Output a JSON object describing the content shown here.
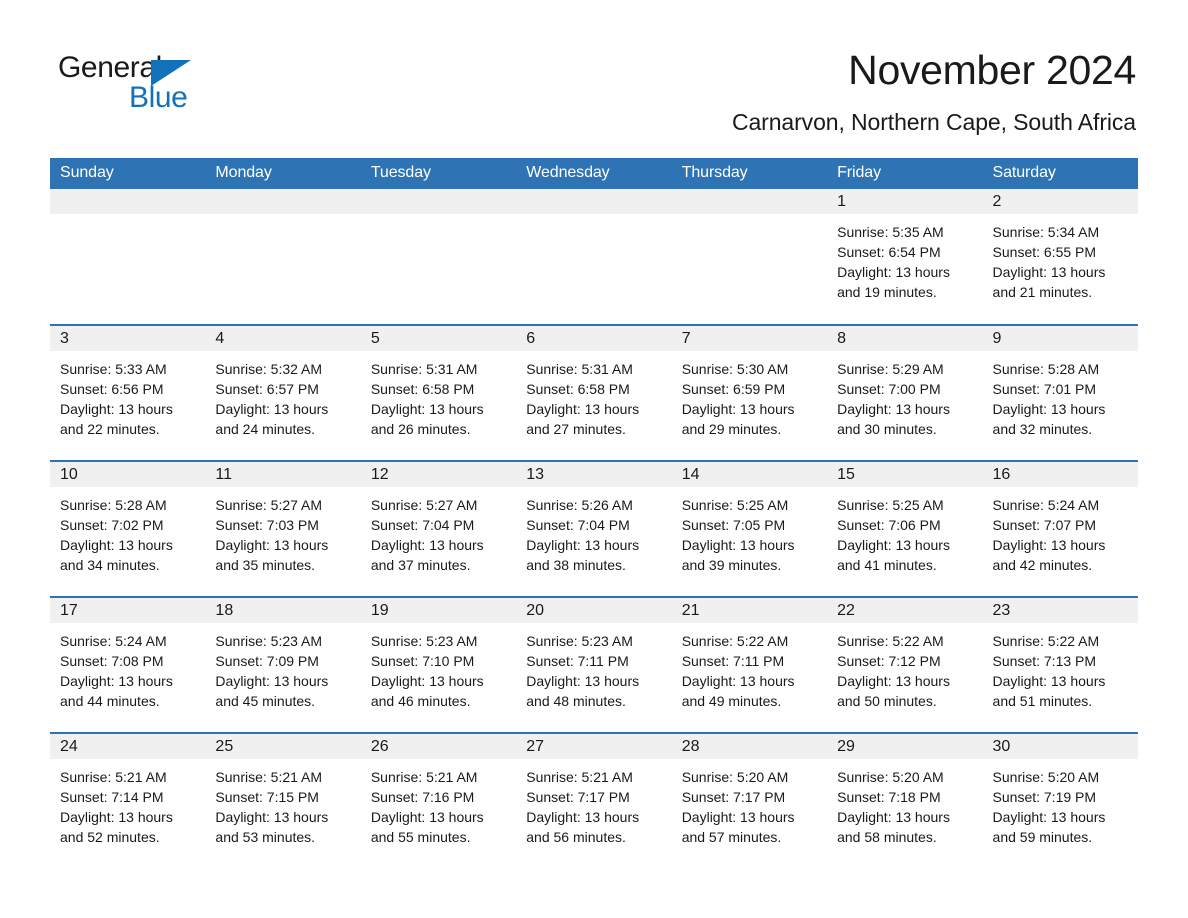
{
  "brand": {
    "logo_word_1": "General",
    "logo_word_2": "Blue",
    "logo_icon": "triangle-icon",
    "accent_color": "#1271bb"
  },
  "header": {
    "title": "November 2024",
    "subtitle": "Carnarvon, Northern Cape, South Africa"
  },
  "theme": {
    "header_blue": "#2e74b5",
    "daynum_band": "#f0f0f0",
    "text": "#1a1a1a"
  },
  "weekday_headers": [
    "Sunday",
    "Monday",
    "Tuesday",
    "Wednesday",
    "Thursday",
    "Friday",
    "Saturday"
  ],
  "weeks": [
    [
      {
        "day": "",
        "lines": []
      },
      {
        "day": "",
        "lines": []
      },
      {
        "day": "",
        "lines": []
      },
      {
        "day": "",
        "lines": []
      },
      {
        "day": "",
        "lines": []
      },
      {
        "day": "1",
        "lines": [
          "Sunrise: 5:35 AM",
          "Sunset: 6:54 PM",
          "Daylight: 13 hours",
          "and 19 minutes."
        ]
      },
      {
        "day": "2",
        "lines": [
          "Sunrise: 5:34 AM",
          "Sunset: 6:55 PM",
          "Daylight: 13 hours",
          "and 21 minutes."
        ]
      }
    ],
    [
      {
        "day": "3",
        "lines": [
          "Sunrise: 5:33 AM",
          "Sunset: 6:56 PM",
          "Daylight: 13 hours",
          "and 22 minutes."
        ]
      },
      {
        "day": "4",
        "lines": [
          "Sunrise: 5:32 AM",
          "Sunset: 6:57 PM",
          "Daylight: 13 hours",
          "and 24 minutes."
        ]
      },
      {
        "day": "5",
        "lines": [
          "Sunrise: 5:31 AM",
          "Sunset: 6:58 PM",
          "Daylight: 13 hours",
          "and 26 minutes."
        ]
      },
      {
        "day": "6",
        "lines": [
          "Sunrise: 5:31 AM",
          "Sunset: 6:58 PM",
          "Daylight: 13 hours",
          "and 27 minutes."
        ]
      },
      {
        "day": "7",
        "lines": [
          "Sunrise: 5:30 AM",
          "Sunset: 6:59 PM",
          "Daylight: 13 hours",
          "and 29 minutes."
        ]
      },
      {
        "day": "8",
        "lines": [
          "Sunrise: 5:29 AM",
          "Sunset: 7:00 PM",
          "Daylight: 13 hours",
          "and 30 minutes."
        ]
      },
      {
        "day": "9",
        "lines": [
          "Sunrise: 5:28 AM",
          "Sunset: 7:01 PM",
          "Daylight: 13 hours",
          "and 32 minutes."
        ]
      }
    ],
    [
      {
        "day": "10",
        "lines": [
          "Sunrise: 5:28 AM",
          "Sunset: 7:02 PM",
          "Daylight: 13 hours",
          "and 34 minutes."
        ]
      },
      {
        "day": "11",
        "lines": [
          "Sunrise: 5:27 AM",
          "Sunset: 7:03 PM",
          "Daylight: 13 hours",
          "and 35 minutes."
        ]
      },
      {
        "day": "12",
        "lines": [
          "Sunrise: 5:27 AM",
          "Sunset: 7:04 PM",
          "Daylight: 13 hours",
          "and 37 minutes."
        ]
      },
      {
        "day": "13",
        "lines": [
          "Sunrise: 5:26 AM",
          "Sunset: 7:04 PM",
          "Daylight: 13 hours",
          "and 38 minutes."
        ]
      },
      {
        "day": "14",
        "lines": [
          "Sunrise: 5:25 AM",
          "Sunset: 7:05 PM",
          "Daylight: 13 hours",
          "and 39 minutes."
        ]
      },
      {
        "day": "15",
        "lines": [
          "Sunrise: 5:25 AM",
          "Sunset: 7:06 PM",
          "Daylight: 13 hours",
          "and 41 minutes."
        ]
      },
      {
        "day": "16",
        "lines": [
          "Sunrise: 5:24 AM",
          "Sunset: 7:07 PM",
          "Daylight: 13 hours",
          "and 42 minutes."
        ]
      }
    ],
    [
      {
        "day": "17",
        "lines": [
          "Sunrise: 5:24 AM",
          "Sunset: 7:08 PM",
          "Daylight: 13 hours",
          "and 44 minutes."
        ]
      },
      {
        "day": "18",
        "lines": [
          "Sunrise: 5:23 AM",
          "Sunset: 7:09 PM",
          "Daylight: 13 hours",
          "and 45 minutes."
        ]
      },
      {
        "day": "19",
        "lines": [
          "Sunrise: 5:23 AM",
          "Sunset: 7:10 PM",
          "Daylight: 13 hours",
          "and 46 minutes."
        ]
      },
      {
        "day": "20",
        "lines": [
          "Sunrise: 5:23 AM",
          "Sunset: 7:11 PM",
          "Daylight: 13 hours",
          "and 48 minutes."
        ]
      },
      {
        "day": "21",
        "lines": [
          "Sunrise: 5:22 AM",
          "Sunset: 7:11 PM",
          "Daylight: 13 hours",
          "and 49 minutes."
        ]
      },
      {
        "day": "22",
        "lines": [
          "Sunrise: 5:22 AM",
          "Sunset: 7:12 PM",
          "Daylight: 13 hours",
          "and 50 minutes."
        ]
      },
      {
        "day": "23",
        "lines": [
          "Sunrise: 5:22 AM",
          "Sunset: 7:13 PM",
          "Daylight: 13 hours",
          "and 51 minutes."
        ]
      }
    ],
    [
      {
        "day": "24",
        "lines": [
          "Sunrise: 5:21 AM",
          "Sunset: 7:14 PM",
          "Daylight: 13 hours",
          "and 52 minutes."
        ]
      },
      {
        "day": "25",
        "lines": [
          "Sunrise: 5:21 AM",
          "Sunset: 7:15 PM",
          "Daylight: 13 hours",
          "and 53 minutes."
        ]
      },
      {
        "day": "26",
        "lines": [
          "Sunrise: 5:21 AM",
          "Sunset: 7:16 PM",
          "Daylight: 13 hours",
          "and 55 minutes."
        ]
      },
      {
        "day": "27",
        "lines": [
          "Sunrise: 5:21 AM",
          "Sunset: 7:17 PM",
          "Daylight: 13 hours",
          "and 56 minutes."
        ]
      },
      {
        "day": "28",
        "lines": [
          "Sunrise: 5:20 AM",
          "Sunset: 7:17 PM",
          "Daylight: 13 hours",
          "and 57 minutes."
        ]
      },
      {
        "day": "29",
        "lines": [
          "Sunrise: 5:20 AM",
          "Sunset: 7:18 PM",
          "Daylight: 13 hours",
          "and 58 minutes."
        ]
      },
      {
        "day": "30",
        "lines": [
          "Sunrise: 5:20 AM",
          "Sunset: 7:19 PM",
          "Daylight: 13 hours",
          "and 59 minutes."
        ]
      }
    ]
  ]
}
